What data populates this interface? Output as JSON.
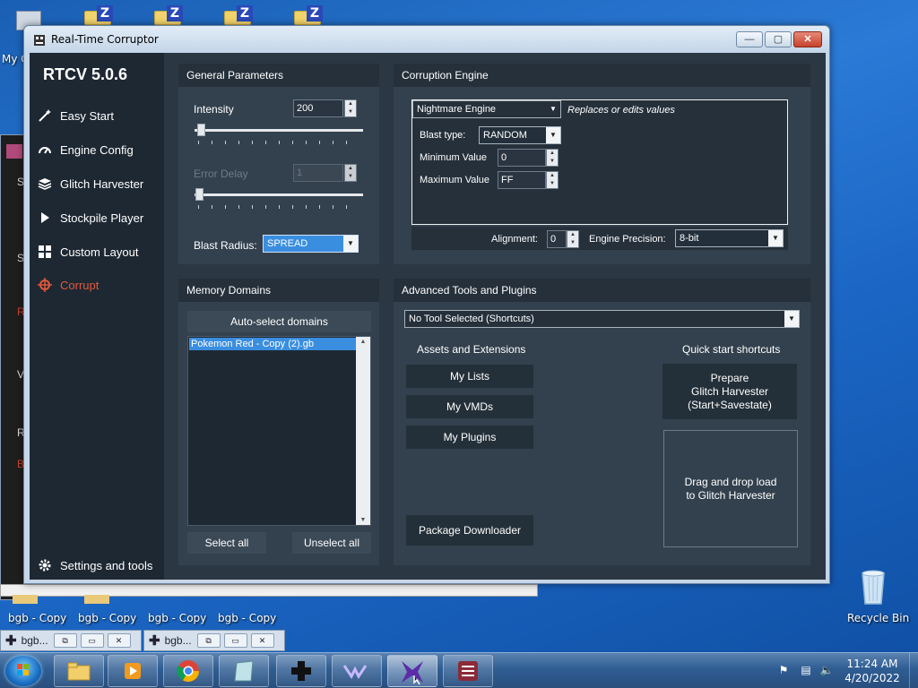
{
  "desktop": {
    "left_label": "My C",
    "bottom_icons": [
      "bgb - Copy",
      "bgb - Copy",
      "bgb - Copy",
      "bgb - Copy"
    ],
    "recycle_bin": "Recycle Bin"
  },
  "window": {
    "title": "Real-Time Corruptor",
    "controls": {
      "minimize": "—",
      "maximize": "▢",
      "close": "✕"
    }
  },
  "sidebar": {
    "app_title": "RTCV 5.0.6",
    "items": [
      {
        "label": "Easy Start",
        "icon": "wand-icon"
      },
      {
        "label": "Engine Config",
        "icon": "gauge-icon"
      },
      {
        "label": "Glitch Harvester",
        "icon": "layers-icon"
      },
      {
        "label": "Stockpile Player",
        "icon": "play-icon"
      },
      {
        "label": "Custom Layout",
        "icon": "grid-icon"
      },
      {
        "label": "Corrupt",
        "icon": "target-icon",
        "active": true
      }
    ],
    "settings": "Settings and tools",
    "active_color": "#e0593b"
  },
  "general": {
    "header": "General Parameters",
    "intensity_label": "Intensity",
    "intensity_value": "200",
    "error_delay_label": "Error Delay",
    "error_delay_value": "1",
    "blast_radius_label": "Blast Radius:",
    "blast_radius_value": "SPREAD"
  },
  "engine": {
    "header": "Corruption Engine",
    "engine_value": "Nightmare Engine",
    "engine_desc": "Replaces or edits values",
    "blast_type_label": "Blast type:",
    "blast_type_value": "RANDOM",
    "min_label": "Minimum Value",
    "min_value": "0",
    "max_label": "Maximum Value",
    "max_value": "FF",
    "alignment_label": "Alignment:",
    "alignment_value": "0",
    "precision_label": "Engine Precision:",
    "precision_value": "8-bit"
  },
  "memory": {
    "header": "Memory Domains",
    "auto_select": "Auto-select domains",
    "domains": [
      "Pokemon Red - Copy (2).gb"
    ],
    "select_all": "Select all",
    "unselect_all": "Unselect all"
  },
  "advanced": {
    "header": "Advanced Tools and Plugins",
    "tool_value": "No Tool Selected (Shortcuts)",
    "assets_title": "Assets and Extensions",
    "assets": [
      "My Lists",
      "My VMDs",
      "My Plugins"
    ],
    "package_downloader": "Package Downloader",
    "quick_title": "Quick start shortcuts",
    "prepare_line1": "Prepare",
    "prepare_line2": "Glitch Harvester",
    "prepare_line3": "(Start+Savestate)",
    "drop_line1": "Drag and drop load",
    "drop_line2": "to Glitch Harvester"
  },
  "minimized": [
    {
      "label": "bgb..."
    },
    {
      "label": "bgb..."
    }
  ],
  "taskbar": {
    "apps": [
      "explorer-icon",
      "media-player-icon",
      "chrome-icon",
      "notepad-icon",
      "gamepad-icon",
      "vanguard-icon",
      "rtc-icon",
      "editor-icon"
    ],
    "time": "11:24 AM",
    "date": "4/20/2022"
  }
}
